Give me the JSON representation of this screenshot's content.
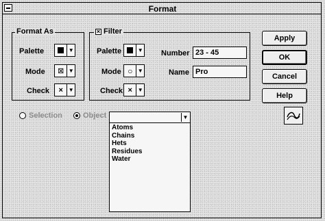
{
  "window": {
    "title": "Format"
  },
  "format_as": {
    "legend": "Format As",
    "palette_label": "Palette",
    "mode_label": "Mode",
    "check_label": "Check",
    "mode_glyph": "⊠",
    "check_glyph": "×"
  },
  "filter": {
    "legend": "Filter",
    "enabled_glyph": "×",
    "palette_label": "Palette",
    "mode_label": "Mode",
    "check_label": "Check",
    "mode_glyph": "○",
    "check_glyph": "×",
    "number_label": "Number",
    "number_value": "23 - 45",
    "name_label": "Name",
    "name_value": "Pro"
  },
  "buttons": {
    "apply": "Apply",
    "ok": "OK",
    "cancel": "Cancel",
    "help": "Help"
  },
  "scope": {
    "selection_label": "Selection",
    "object_label": "Object",
    "selected": "object"
  },
  "object_dropdown": {
    "value": "",
    "options": [
      "Atoms",
      "Chains",
      "Hets",
      "Residues",
      "Water"
    ]
  },
  "arrow_glyph": "▼"
}
